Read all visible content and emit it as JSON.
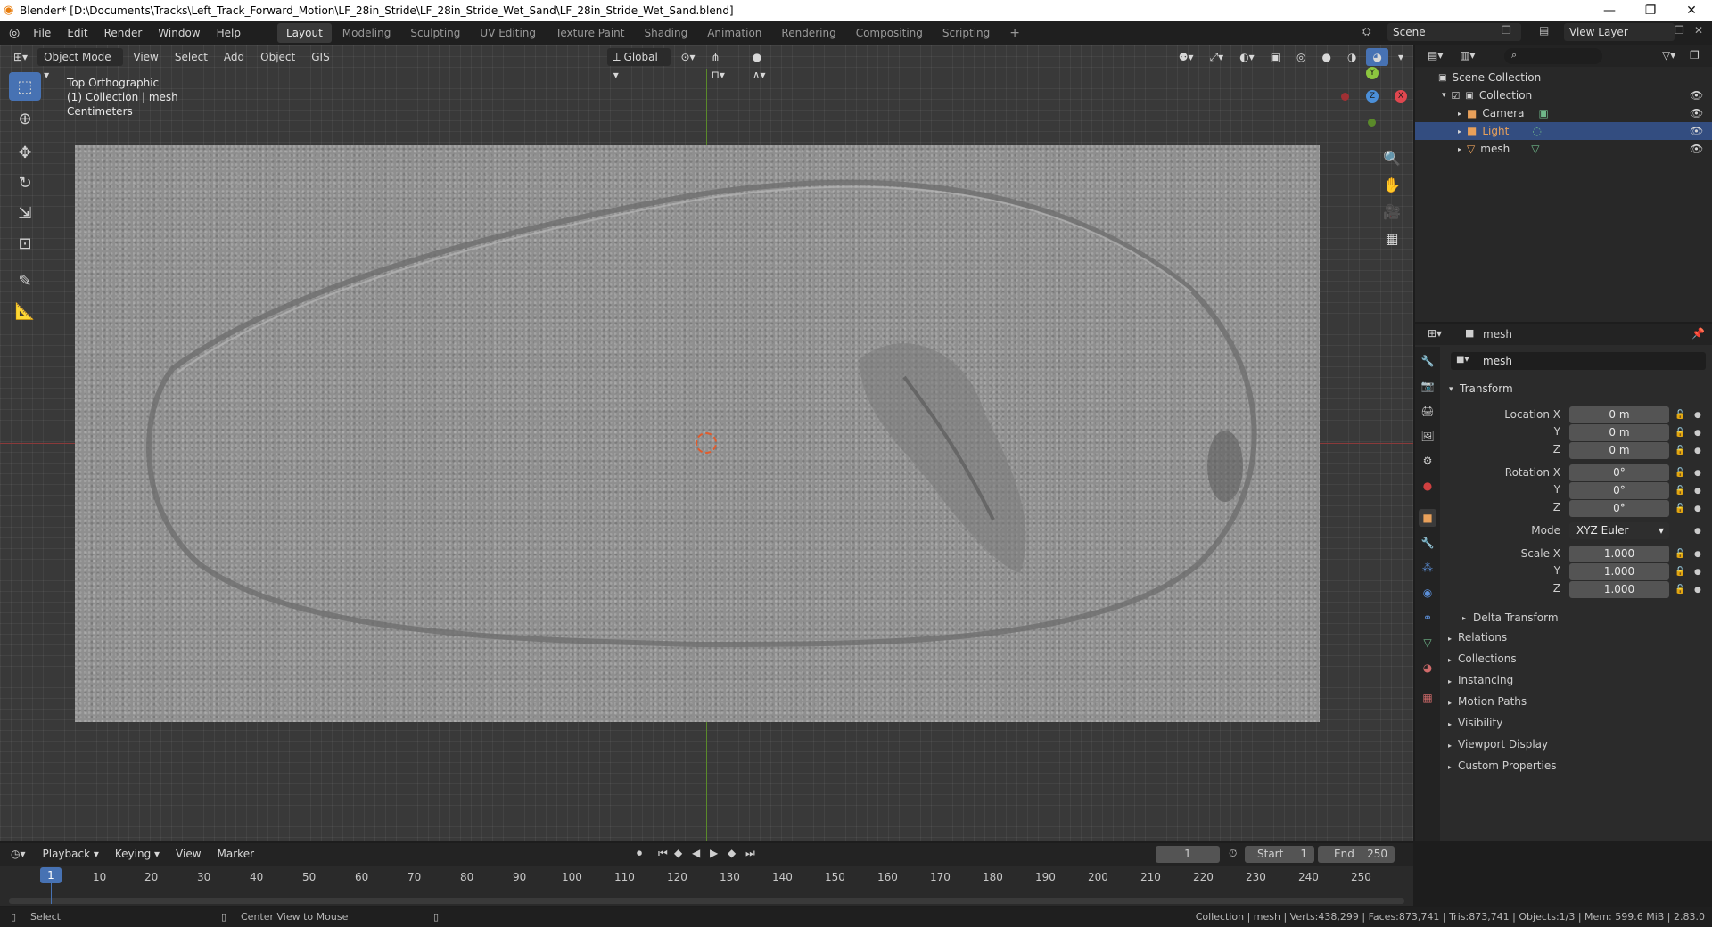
{
  "window": {
    "title": "Blender* [D:\\Documents\\Tracks\\Left_Track_Forward_Motion\\LF_28in_Stride\\LF_28in_Stride_Wet_Sand\\LF_28in_Stride_Wet_Sand.blend]"
  },
  "menubar": {
    "items": [
      "File",
      "Edit",
      "Render",
      "Window",
      "Help"
    ],
    "workspaces": [
      "Layout",
      "Modeling",
      "Sculpting",
      "UV Editing",
      "Texture Paint",
      "Shading",
      "Animation",
      "Rendering",
      "Compositing",
      "Scripting"
    ],
    "active_workspace": "Layout",
    "scene_label": "Scene",
    "view_layer_label": "View Layer"
  },
  "viewport": {
    "mode": "Object Mode",
    "menus": [
      "View",
      "Select",
      "Add",
      "Object",
      "GIS"
    ],
    "transform_orientation": "Global",
    "overlay_lines": [
      "Top Orthographic",
      "(1) Collection | mesh",
      "Centimeters"
    ],
    "gizmo": {
      "x": "X",
      "y": "Y",
      "z": "Z"
    }
  },
  "outliner": {
    "root": "Scene Collection",
    "collection": "Collection",
    "objects": [
      {
        "name": "Camera",
        "selected": false,
        "color": "#d6d6d6"
      },
      {
        "name": "Light",
        "selected": true,
        "color": "#e8a05a"
      },
      {
        "name": "mesh",
        "selected": false,
        "color": "#d6d6d6"
      }
    ]
  },
  "properties": {
    "object_name_header": "mesh",
    "object_name_field": "mesh",
    "transform_label": "Transform",
    "location": {
      "label": "Location X",
      "x": "0 m",
      "y": "0 m",
      "z": "0 m"
    },
    "rotation": {
      "label": "Rotation X",
      "x": "0°",
      "y": "0°",
      "z": "0°"
    },
    "mode": {
      "label": "Mode",
      "value": "XYZ Euler"
    },
    "scale": {
      "label": "Scale X",
      "x": "1.000",
      "y": "1.000",
      "z": "1.000"
    },
    "axis_y": "Y",
    "axis_z": "Z",
    "delta_transform": "Delta Transform",
    "sections": [
      "Relations",
      "Collections",
      "Instancing",
      "Motion Paths",
      "Visibility",
      "Viewport Display",
      "Custom Properties"
    ]
  },
  "timeline": {
    "menus": [
      "Playback",
      "Keying",
      "View",
      "Marker"
    ],
    "current_frame": "1",
    "start_label": "Start",
    "start": "1",
    "end_label": "End",
    "end": "250",
    "frames": [
      "1",
      "10",
      "20",
      "30",
      "40",
      "50",
      "60",
      "70",
      "80",
      "90",
      "100",
      "110",
      "120",
      "130",
      "140",
      "150",
      "160",
      "170",
      "180",
      "190",
      "200",
      "210",
      "220",
      "230",
      "240",
      "250"
    ]
  },
  "statusbar": {
    "left": "Select",
    "middle": "Center View to Mouse",
    "right": "Collection | mesh | Verts:438,299 | Faces:873,741 | Tris:873,741 | Objects:1/3 | Mem: 599.6 MiB | 2.83.0"
  }
}
